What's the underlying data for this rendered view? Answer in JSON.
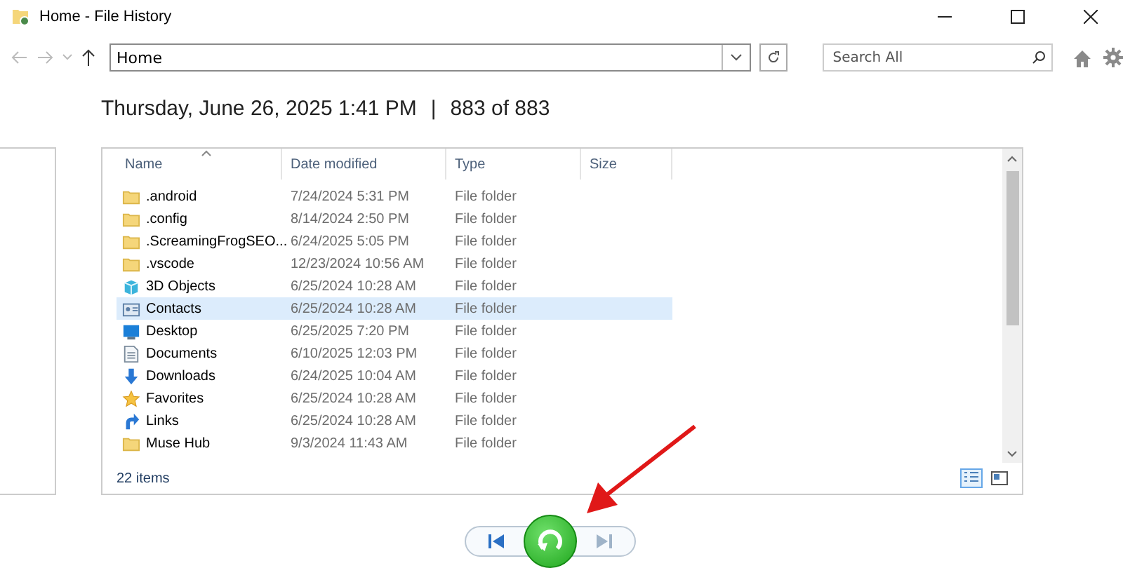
{
  "window": {
    "title": "Home - File History"
  },
  "address": {
    "value": "Home"
  },
  "search": {
    "placeholder": "Search All"
  },
  "snapshot": {
    "date": "Thursday, June 26, 2025 1:41 PM",
    "separator": "|",
    "position": "883 of 883"
  },
  "table": {
    "columns": [
      "Name",
      "Date modified",
      "Type",
      "Size"
    ],
    "rows": [
      {
        "kind": "folder",
        "name": ".android",
        "date": "7/24/2024 5:31 PM",
        "type": "File folder",
        "selected": false
      },
      {
        "kind": "folder",
        "name": ".config",
        "date": "8/14/2024 2:50 PM",
        "type": "File folder",
        "selected": false
      },
      {
        "kind": "folder",
        "name": ".ScreamingFrogSEO...",
        "date": "6/24/2025 5:05 PM",
        "type": "File folder",
        "selected": false
      },
      {
        "kind": "folder",
        "name": ".vscode",
        "date": "12/23/2024 10:56 AM",
        "type": "File folder",
        "selected": false
      },
      {
        "kind": "objects",
        "name": "3D Objects",
        "date": "6/25/2024 10:28 AM",
        "type": "File folder",
        "selected": false
      },
      {
        "kind": "contacts",
        "name": "Contacts",
        "date": "6/25/2024 10:28 AM",
        "type": "File folder",
        "selected": true
      },
      {
        "kind": "desktop",
        "name": "Desktop",
        "date": "6/25/2025 7:20 PM",
        "type": "File folder",
        "selected": false
      },
      {
        "kind": "documents",
        "name": "Documents",
        "date": "6/10/2025 12:03 PM",
        "type": "File folder",
        "selected": false
      },
      {
        "kind": "downloads",
        "name": "Downloads",
        "date": "6/24/2025 10:04 AM",
        "type": "File folder",
        "selected": false
      },
      {
        "kind": "favorites",
        "name": "Favorites",
        "date": "6/25/2024 10:28 AM",
        "type": "File folder",
        "selected": false
      },
      {
        "kind": "links",
        "name": "Links",
        "date": "6/25/2024 10:28 AM",
        "type": "File folder",
        "selected": false
      },
      {
        "kind": "folder",
        "name": "Muse Hub",
        "date": "9/3/2024 11:43 AM",
        "type": "File folder",
        "selected": false
      }
    ]
  },
  "status_bar": {
    "items": "22 items"
  }
}
